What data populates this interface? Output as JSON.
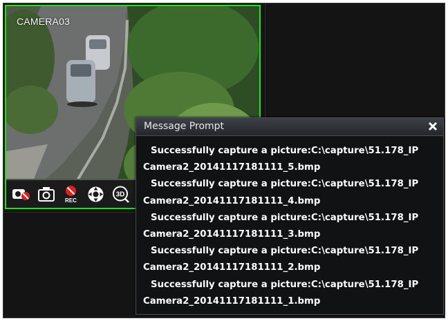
{
  "camera": {
    "label": "CAMERA03",
    "border_color": "#19e619",
    "toolbar": {
      "buttons": [
        {
          "name": "stop-preview-button",
          "icon": "camera-disabled-icon"
        },
        {
          "name": "snapshot-button",
          "icon": "camera-icon"
        },
        {
          "name": "record-button",
          "icon": "rec-icon",
          "text": "REC"
        },
        {
          "name": "ptz-button",
          "icon": "ptz-icon"
        },
        {
          "name": "3d-zoom-button",
          "icon": "3d-icon",
          "text": "3D"
        }
      ]
    }
  },
  "prompt": {
    "title": "Message Prompt",
    "close_icon": "close-icon",
    "messages": [
      {
        "line1": "Successfully capture a picture:C:\\capture\\51.178_IP",
        "line2": "Camera2_20141117181111_5.bmp"
      },
      {
        "line1": "Successfully capture a picture:C:\\capture\\51.178_IP",
        "line2": "Camera2_20141117181111_4.bmp"
      },
      {
        "line1": "Successfully capture a picture:C:\\capture\\51.178_IP",
        "line2": "Camera2_20141117181111_3.bmp"
      },
      {
        "line1": "Successfully capture a picture:C:\\capture\\51.178_IP",
        "line2": "Camera2_20141117181111_2.bmp"
      },
      {
        "line1": "Successfully capture a picture:C:\\capture\\51.178_IP",
        "line2": "Camera2_20141117181111_1.bmp"
      }
    ]
  }
}
